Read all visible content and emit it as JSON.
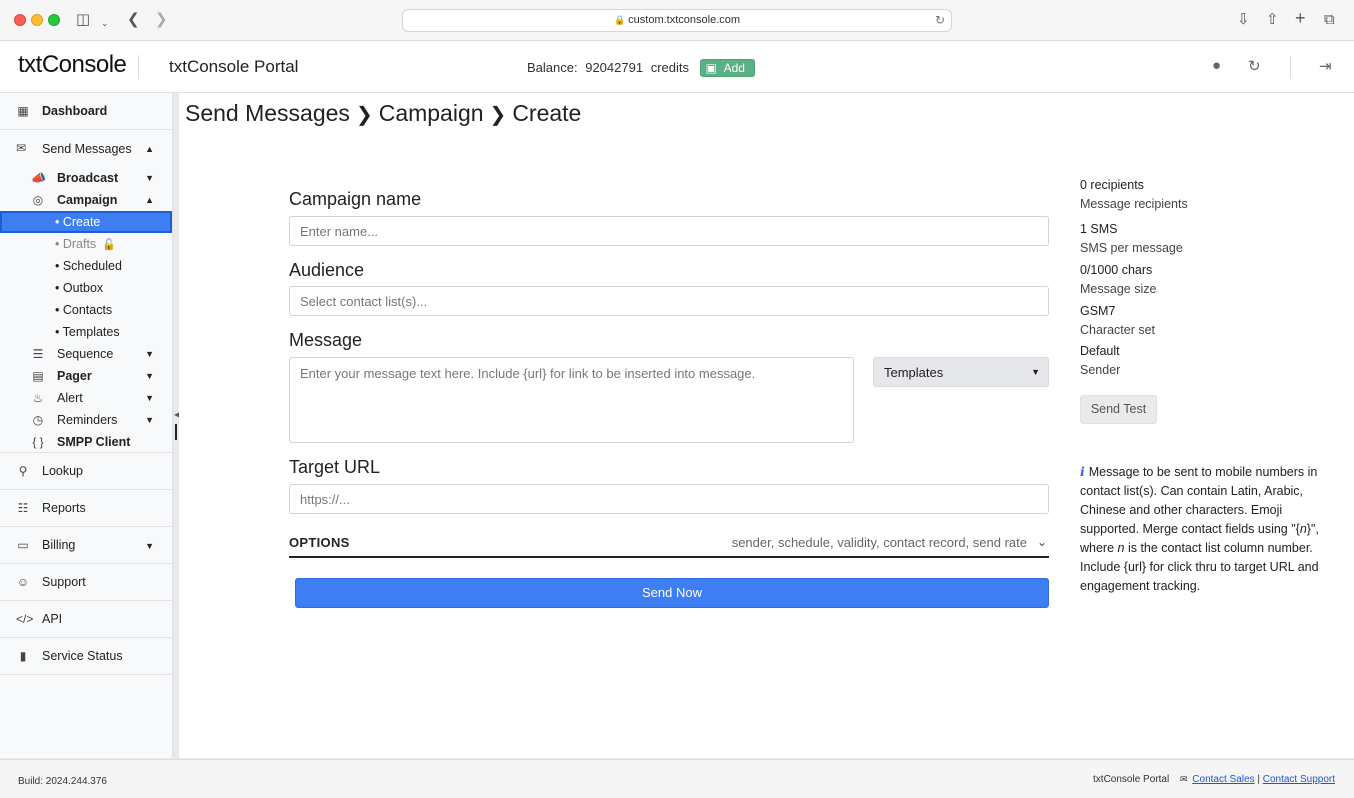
{
  "browser": {
    "url": "custom.txtconsole.com"
  },
  "header": {
    "brand": "txtConsole",
    "portal_title": "txtConsole Portal",
    "balance_label": "Balance:",
    "balance_value": "92042791",
    "balance_unit": "credits",
    "add_label": "Add"
  },
  "sidebar": {
    "dashboard": "Dashboard",
    "send_messages": "Send Messages",
    "broadcast": "Broadcast",
    "campaign": "Campaign",
    "campaign_items": [
      "• Create",
      "• Drafts",
      "• Scheduled",
      "• Outbox",
      "• Contacts",
      "• Templates"
    ],
    "sequence": "Sequence",
    "pager": "Pager",
    "alert": "Alert",
    "reminders": "Reminders",
    "smpp_client": "SMPP Client",
    "lookup": "Lookup",
    "reports": "Reports",
    "billing": "Billing",
    "support": "Support",
    "api": "API",
    "service_status": "Service Status"
  },
  "breadcrumb": [
    "Send Messages",
    "Campaign",
    "Create"
  ],
  "form": {
    "campaign_name_label": "Campaign name",
    "campaign_name_placeholder": "Enter name...",
    "audience_label": "Audience",
    "audience_placeholder": "Select contact list(s)...",
    "message_label": "Message",
    "message_placeholder": "Enter your message text here. Include {url} for link to be inserted into message.",
    "templates_select": "Templates",
    "target_url_label": "Target URL",
    "target_url_placeholder": "https://...",
    "options_title": "OPTIONS",
    "options_hint": "sender, schedule, validity, contact record, send rate",
    "send_now": "Send Now"
  },
  "stats": {
    "recipients_value": "0 recipients",
    "recipients_label": "Message recipients",
    "sms_value": "1 SMS",
    "sms_label": "SMS per message",
    "chars_value": "0/1000 chars",
    "chars_label": "Message size",
    "charset_value": "GSM7",
    "charset_label": "Character set",
    "sender_value": "Default",
    "sender_label": "Sender",
    "send_test": "Send Test"
  },
  "info": {
    "text_1": "Message to be sent to mobile numbers in contact list(s). Can contain Latin, Arabic, Chinese and other characters. Emoji supported. Merge contact fields using \"{",
    "n": "n",
    "text_2": "}\", where ",
    "n2": "n",
    "text_3": " is the contact list column number. Include {url} for click thru to target URL and engagement tracking."
  },
  "footer": {
    "build": "Build: 2024.244.376",
    "portal": "txtConsole Portal",
    "contact_sales": "Contact Sales",
    "divider": "|",
    "contact_support": "Contact Support"
  }
}
